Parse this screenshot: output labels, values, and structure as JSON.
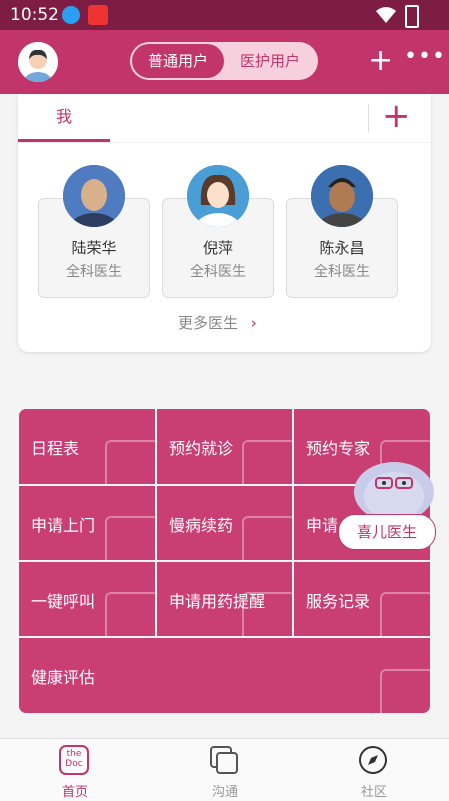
{
  "status": {
    "time": "10:52"
  },
  "header": {
    "tab_user": "普通用户",
    "tab_care": "医护用户"
  },
  "card": {
    "tab_me": "我",
    "doctors": [
      {
        "name": "陆荣华",
        "role": "全科医生"
      },
      {
        "name": "倪萍",
        "role": "全科医生"
      },
      {
        "name": "陈永昌",
        "role": "全科医生"
      }
    ],
    "more": "更多医生"
  },
  "services": [
    "日程表",
    "预约就诊",
    "预约专家",
    "申请上门",
    "慢病续药",
    "申请",
    "一键呼叫",
    "申请用药提醒",
    "服务记录",
    "健康评估"
  ],
  "assistant": {
    "label": "喜儿医生"
  },
  "nav": {
    "home": "首页",
    "home_logo_top": "the",
    "home_logo_bottom": "Doc",
    "chat": "沟通",
    "community": "社区"
  },
  "colors": {
    "primary": "#c1356a",
    "tile": "#c93f74",
    "statusbar": "#7e1d44"
  }
}
